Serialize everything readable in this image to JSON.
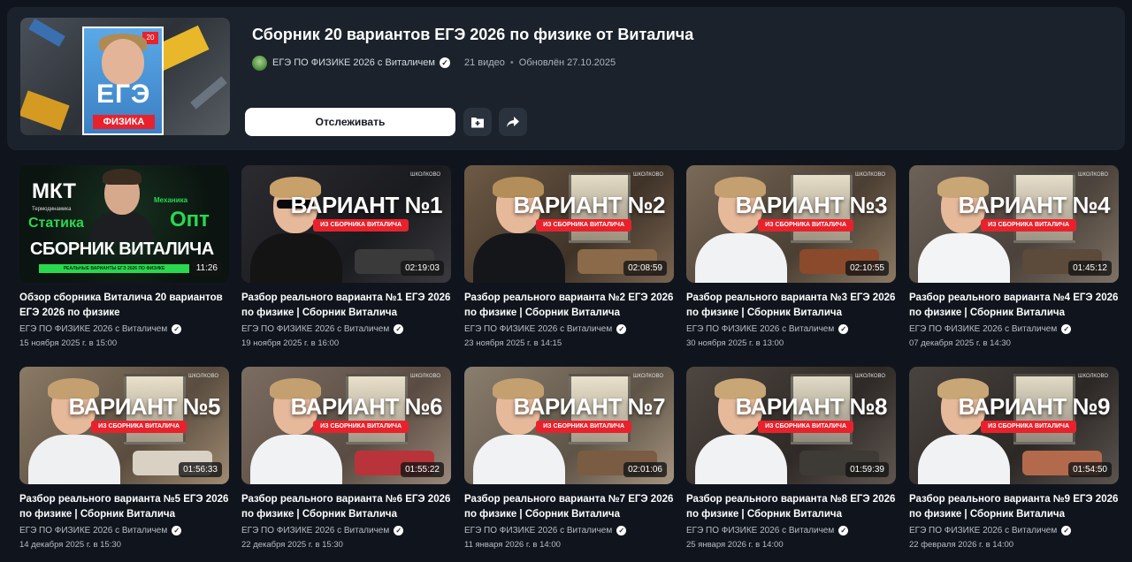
{
  "playlist": {
    "title": "Сборник 20 вариантов ЕГЭ 2026 по физике от Виталича",
    "channel": "ЕГЭ ПО ФИЗИКЕ 2026 с Виталичем",
    "video_count": "21 видео",
    "separator": "•",
    "updated": "Обновлён 27.10.2025",
    "follow_label": "Отслеживать",
    "cover": {
      "ege": "ЕГЭ",
      "subject": "ФИЗИКА",
      "badge": "20"
    }
  },
  "icons": {
    "verified": "verified-check-icon",
    "save": "add-to-folder-icon",
    "share": "share-arrow-icon"
  },
  "colors": {
    "background": "#10151d",
    "panel": "#1b222c",
    "accent_red": "#e8222c",
    "accent_green": "#29d84f"
  },
  "intro_thumb": {
    "mkt": "МКТ",
    "term": "Термодинамика",
    "stat": "Статика",
    "mech": "Механика",
    "opt": "Опт",
    "big": "СБОРНИК ВИТАЛИЧА",
    "bar": "РЕАЛЬНЫЕ ВАРИАНТЫ ЕГЭ 2026 ПО ФИЗИКЕ"
  },
  "thumb_subtitle": "ИЗ СБОРНИКА ВИТАЛИЧА",
  "brand_mark": "ШКОЛКОВО",
  "videos": [
    {
      "title": "Обзор сборника Виталича 20 вариантов ЕГЭ 2026 по физике",
      "channel": "ЕГЭ ПО ФИЗИКЕ 2026 с Виталичем",
      "date": "15 ноября 2025 г. в 15:00",
      "duration": "11:26",
      "variant": ""
    },
    {
      "title": "Разбор реального варианта №1 ЕГЭ 2026 по физике | Сборник Виталича",
      "channel": "ЕГЭ ПО ФИЗИКЕ 2026 с Виталичем",
      "date": "19 ноября 2025 г. в 16:00",
      "duration": "02:19:03",
      "variant": "ВАРИАНТ №1"
    },
    {
      "title": "Разбор реального варианта №2 ЕГЭ 2026 по физике | Сборник Виталича",
      "channel": "ЕГЭ ПО ФИЗИКЕ 2026 с Виталичем",
      "date": "23 ноября 2025 г. в 14:15",
      "duration": "02:08:59",
      "variant": "ВАРИАНТ №2"
    },
    {
      "title": "Разбор реального варианта №3 ЕГЭ 2026 по физике | Сборник Виталича",
      "channel": "ЕГЭ ПО ФИЗИКЕ 2026 с Виталичем",
      "date": "30 ноября 2025 г. в 13:00",
      "duration": "02:10:55",
      "variant": "ВАРИАНТ №3"
    },
    {
      "title": "Разбор реального варианта №4 ЕГЭ 2026 по физике | Сборник Виталича",
      "channel": "ЕГЭ ПО ФИЗИКЕ 2026 с Виталичем",
      "date": "07 декабря 2025 г. в 14:30",
      "duration": "01:45:12",
      "variant": "ВАРИАНТ №4"
    },
    {
      "title": "Разбор реального варианта №5 ЕГЭ 2026 по физике | Сборник Виталича",
      "channel": "ЕГЭ ПО ФИЗИКЕ 2026 с Виталичем",
      "date": "14 декабря 2025 г. в 15:30",
      "duration": "01:56:33",
      "variant": "ВАРИАНТ №5"
    },
    {
      "title": "Разбор реального варианта №6 ЕГЭ 2026 по физике | Сборник Виталича",
      "channel": "ЕГЭ ПО ФИЗИКЕ 2026 с Виталичем",
      "date": "22 декабря 2025 г. в 15:30",
      "duration": "01:55:22",
      "variant": "ВАРИАНТ №6"
    },
    {
      "title": "Разбор реального варианта №7 ЕГЭ 2026 по физике | Сборник Виталича",
      "channel": "ЕГЭ ПО ФИЗИКЕ 2026 с Виталичем",
      "date": "11 января 2026 г. в 14:00",
      "duration": "02:01:06",
      "variant": "ВАРИАНТ №7"
    },
    {
      "title": "Разбор реального варианта №8 ЕГЭ 2026 по физике | Сборник Виталича",
      "channel": "ЕГЭ ПО ФИЗИКЕ 2026 с Виталичем",
      "date": "25 января 2026 г. в 14:00",
      "duration": "01:59:39",
      "variant": "ВАРИАНТ №8"
    },
    {
      "title": "Разбор реального варианта №9 ЕГЭ 2026 по физике | Сборник Виталича",
      "channel": "ЕГЭ ПО ФИЗИКЕ 2026 с Виталичем",
      "date": "22 февраля 2026 г. в 14:00",
      "duration": "01:54:50",
      "variant": "ВАРИАНТ №9"
    }
  ]
}
